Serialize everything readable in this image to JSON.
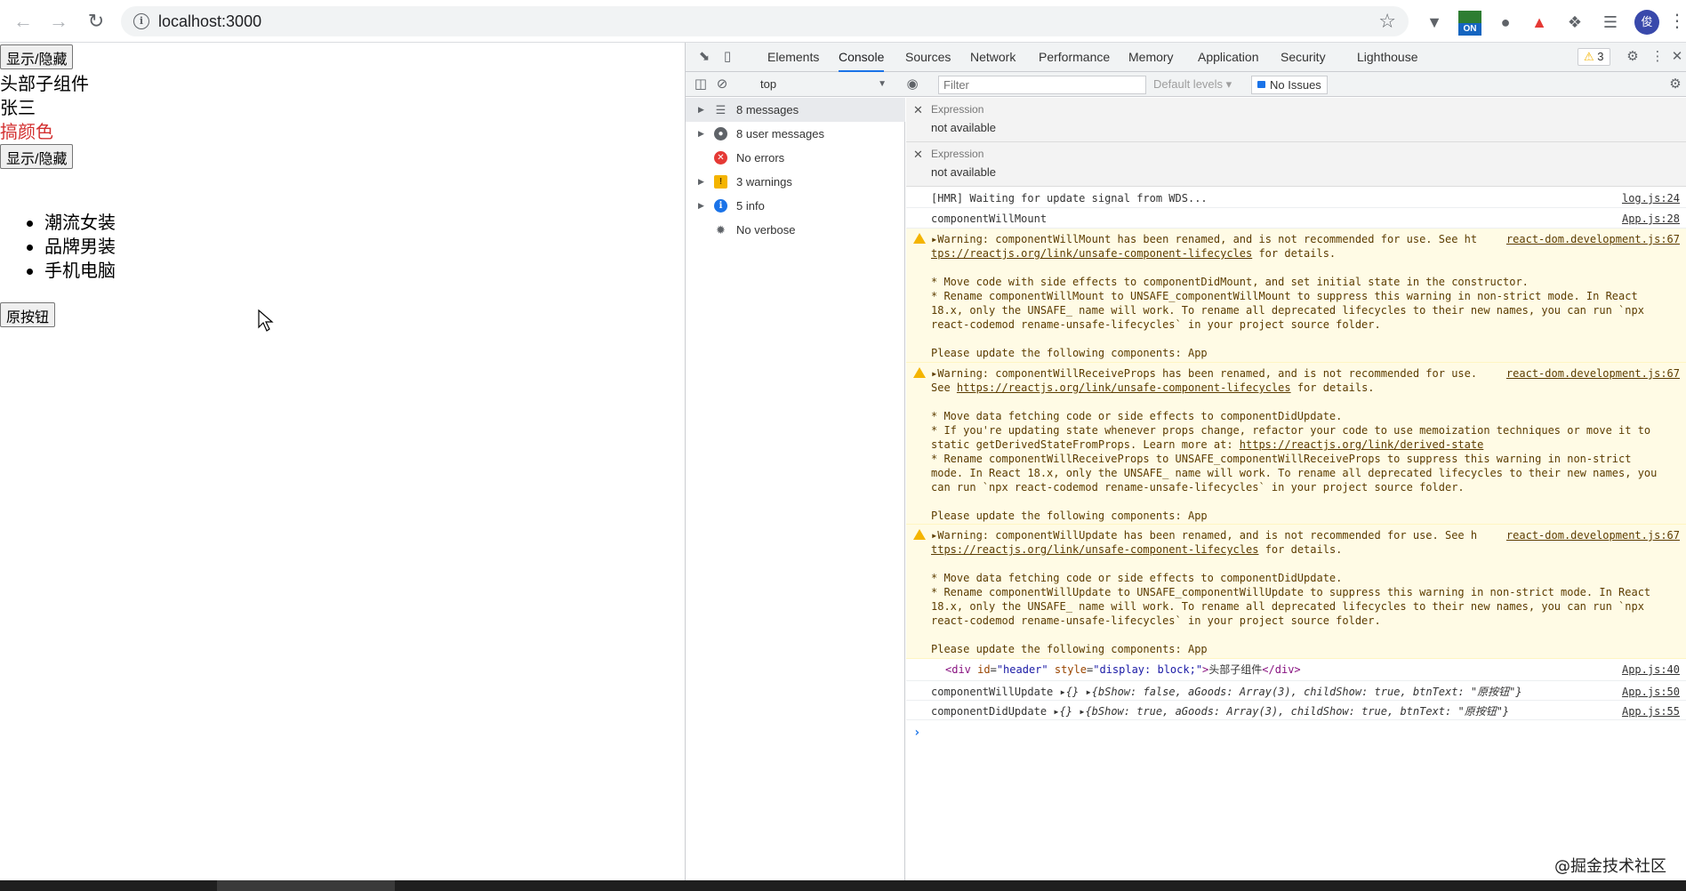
{
  "browser": {
    "url": "localhost:3000",
    "avatar_letter": "俊",
    "ext_on_label": "ON"
  },
  "page": {
    "toggle_button_1": "显示/隐藏",
    "header_text": "头部子组件",
    "name_text": "张三",
    "color_text": "搞颜色",
    "toggle_button_2": "显示/隐藏",
    "goods": [
      "潮流女装",
      "品牌男装",
      "手机电脑"
    ],
    "orig_button": "原按钮"
  },
  "devtools": {
    "tabs": [
      "Elements",
      "Console",
      "Sources",
      "Network",
      "Performance",
      "Memory",
      "Application",
      "Security",
      "Lighthouse"
    ],
    "active_tab": "Console",
    "warn_count": "3",
    "context": "top",
    "filter_placeholder": "Filter",
    "levels": "Default levels",
    "issues": "No Issues",
    "sidebar": [
      {
        "label": "8 messages",
        "icon": "list"
      },
      {
        "label": "8 user messages",
        "icon": "user"
      },
      {
        "label": "No errors",
        "icon": "error"
      },
      {
        "label": "3 warnings",
        "icon": "warning"
      },
      {
        "label": "5 info",
        "icon": "info"
      },
      {
        "label": "No verbose",
        "icon": "verbose"
      }
    ],
    "expressions": [
      {
        "title": "Expression",
        "value": "not available"
      },
      {
        "title": "Expression",
        "value": "not available"
      }
    ],
    "messages": {
      "hmr": {
        "text": "[HMR] Waiting for update signal from WDS...",
        "src": "log.js:24"
      },
      "cwm": {
        "text": "componentWillMount",
        "src": "App.js:28"
      },
      "w1": {
        "src": "react-dom.development.js:67",
        "l1": "Warning: componentWillMount has been renamed, and is not recommended for use. See ht",
        "l2link": "tps://reactjs.org/link/unsafe-component-lifecycles",
        "l2rest": " for details.",
        "l3": "* Move code with side effects to componentDidMount, and set initial state in the constructor.",
        "l4": "* Rename componentWillMount to UNSAFE_componentWillMount to suppress this warning in non-strict mode. In React",
        "l5": "18.x, only the UNSAFE_ name will work. To rename all deprecated lifecycles to their new names, you can run `npx",
        "l6": "react-codemod rename-unsafe-lifecycles` in your project source folder.",
        "l7": "Please update the following components: App"
      },
      "w2": {
        "src": "react-dom.development.js:67",
        "l1": "Warning: componentWillReceiveProps has been renamed, and is not recommended for use.",
        "l2a": "See ",
        "l2link": "https://reactjs.org/link/unsafe-component-lifecycles",
        "l2rest": " for details.",
        "l3": "* Move data fetching code or side effects to componentDidUpdate.",
        "l4": "* If you're updating state whenever props change, refactor your code to use memoization techniques or move it to",
        "l5a": "static getDerivedStateFromProps. Learn more at: ",
        "l5link": "https://reactjs.org/link/derived-state",
        "l6": "* Rename componentWillReceiveProps to UNSAFE_componentWillReceiveProps to suppress this warning in non-strict",
        "l7": "mode. In React 18.x, only the UNSAFE_ name will work. To rename all deprecated lifecycles to their new names, you",
        "l8": "can run `npx react-codemod rename-unsafe-lifecycles` in your project source folder.",
        "l9": "Please update the following components: App"
      },
      "w3": {
        "src": "react-dom.development.js:67",
        "l1": "Warning: componentWillUpdate has been renamed, and is not recommended for use. See h",
        "l2link": "ttps://reactjs.org/link/unsafe-component-lifecycles",
        "l2rest": " for details.",
        "l3": "* Move data fetching code or side effects to componentDidUpdate.",
        "l4": "* Rename componentWillUpdate to UNSAFE_componentWillUpdate to suppress this warning in non-strict mode. In React",
        "l5": "18.x, only the UNSAFE_ name will work. To rename all deprecated lifecycles to their new names, you can run `npx",
        "l6": "react-codemod rename-unsafe-lifecycles` in your project source folder.",
        "l7": "Please update the following components: App"
      },
      "div": {
        "src": "App.js:40",
        "tag_open": "<div",
        "attr1": "id",
        "val1": "\"header\"",
        "attr2": "style",
        "val2": "\"display: block;\"",
        "content": "头部子组件",
        "tag_close": "</div>"
      },
      "cwu": {
        "label": "componentWillUpdate",
        "obj": "{}",
        "state": "{bShow: false, aGoods: Array(3), childShow: true, btnText: \"原按钮\"}",
        "src": "App.js:50"
      },
      "cdu": {
        "label": "componentDidUpdate",
        "obj": "{}",
        "state": "{bShow: true, aGoods: Array(3), childShow: true, btnText: \"原按钮\"}",
        "src": "App.js:55"
      }
    }
  },
  "watermark": "@掘金技术社区"
}
